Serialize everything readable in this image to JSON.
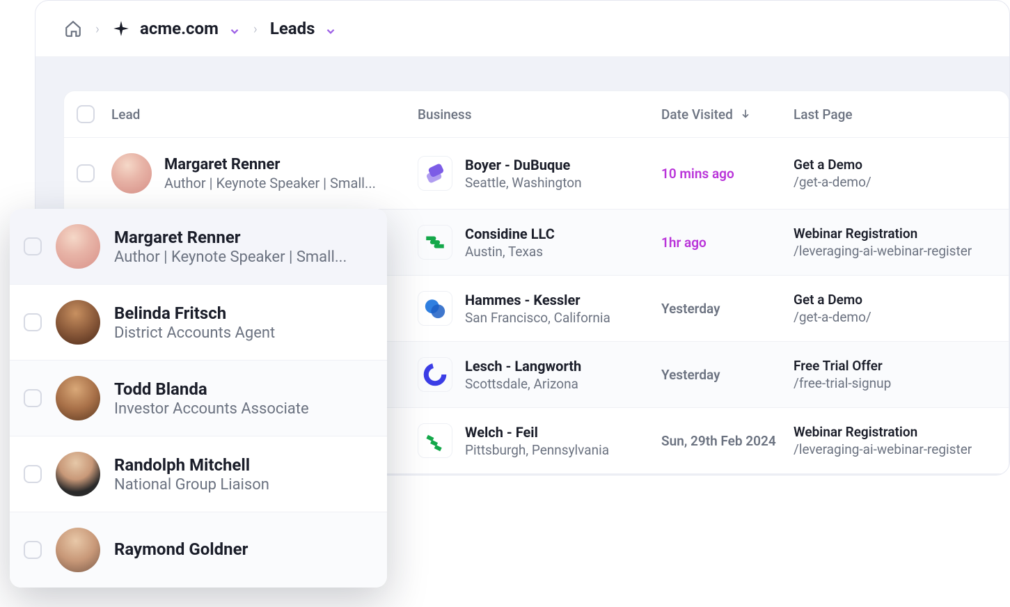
{
  "breadcrumb": {
    "site": "acme.com",
    "section": "Leads"
  },
  "columns": {
    "lead": "Lead",
    "business": "Business",
    "date": "Date Visited",
    "last_page": "Last Page"
  },
  "rows": [
    {
      "name": "Margaret Renner",
      "title": "Author | Keynote Speaker | Small...",
      "biz_name": "Boyer - DuBuque",
      "biz_loc": "Seattle, Washington",
      "date": "10 mins ago",
      "recent": true,
      "page_title": "Get a Demo",
      "page_path": "/get-a-demo/"
    },
    {
      "name": "",
      "title": "",
      "biz_name": "Considine LLC",
      "biz_loc": "Austin, Texas",
      "date": "1hr ago",
      "recent": true,
      "page_title": "Webinar Registration",
      "page_path": "/leveraging-ai-webinar-register"
    },
    {
      "name": "",
      "title": "",
      "biz_name": "Hammes - Kessler",
      "biz_loc": "San Francisco, California",
      "date": "Yesterday",
      "recent": false,
      "page_title": "Get a Demo",
      "page_path": "/get-a-demo/"
    },
    {
      "name": "",
      "title": "",
      "biz_name": "Lesch - Langworth",
      "biz_loc": "Scottsdale, Arizona",
      "date": "Yesterday",
      "recent": false,
      "page_title": "Free Trial Offer",
      "page_path": "/free-trial-signup"
    },
    {
      "name": "",
      "title": "",
      "biz_name": "Welch - Feil",
      "biz_loc": "Pittsburgh, Pennsylvania",
      "date": "Sun, 29th Feb 2024",
      "recent": false,
      "page_title": "Webinar Registration",
      "page_path": "/leveraging-ai-webinar-register"
    }
  ],
  "overlay": [
    {
      "name": "Margaret Renner",
      "title": "Author | Keynote Speaker | Small..."
    },
    {
      "name": "Belinda Fritsch",
      "title": "District Accounts Agent"
    },
    {
      "name": "Todd Blanda",
      "title": "Investor Accounts Associate"
    },
    {
      "name": "Randolph Mitchell",
      "title": "National Group Liaison"
    },
    {
      "name": "Raymond Goldner",
      "title": ""
    }
  ],
  "logos": {
    "0": "stack",
    "1": "zig",
    "2": "bubbles",
    "3": "ring",
    "4": "stripes"
  }
}
